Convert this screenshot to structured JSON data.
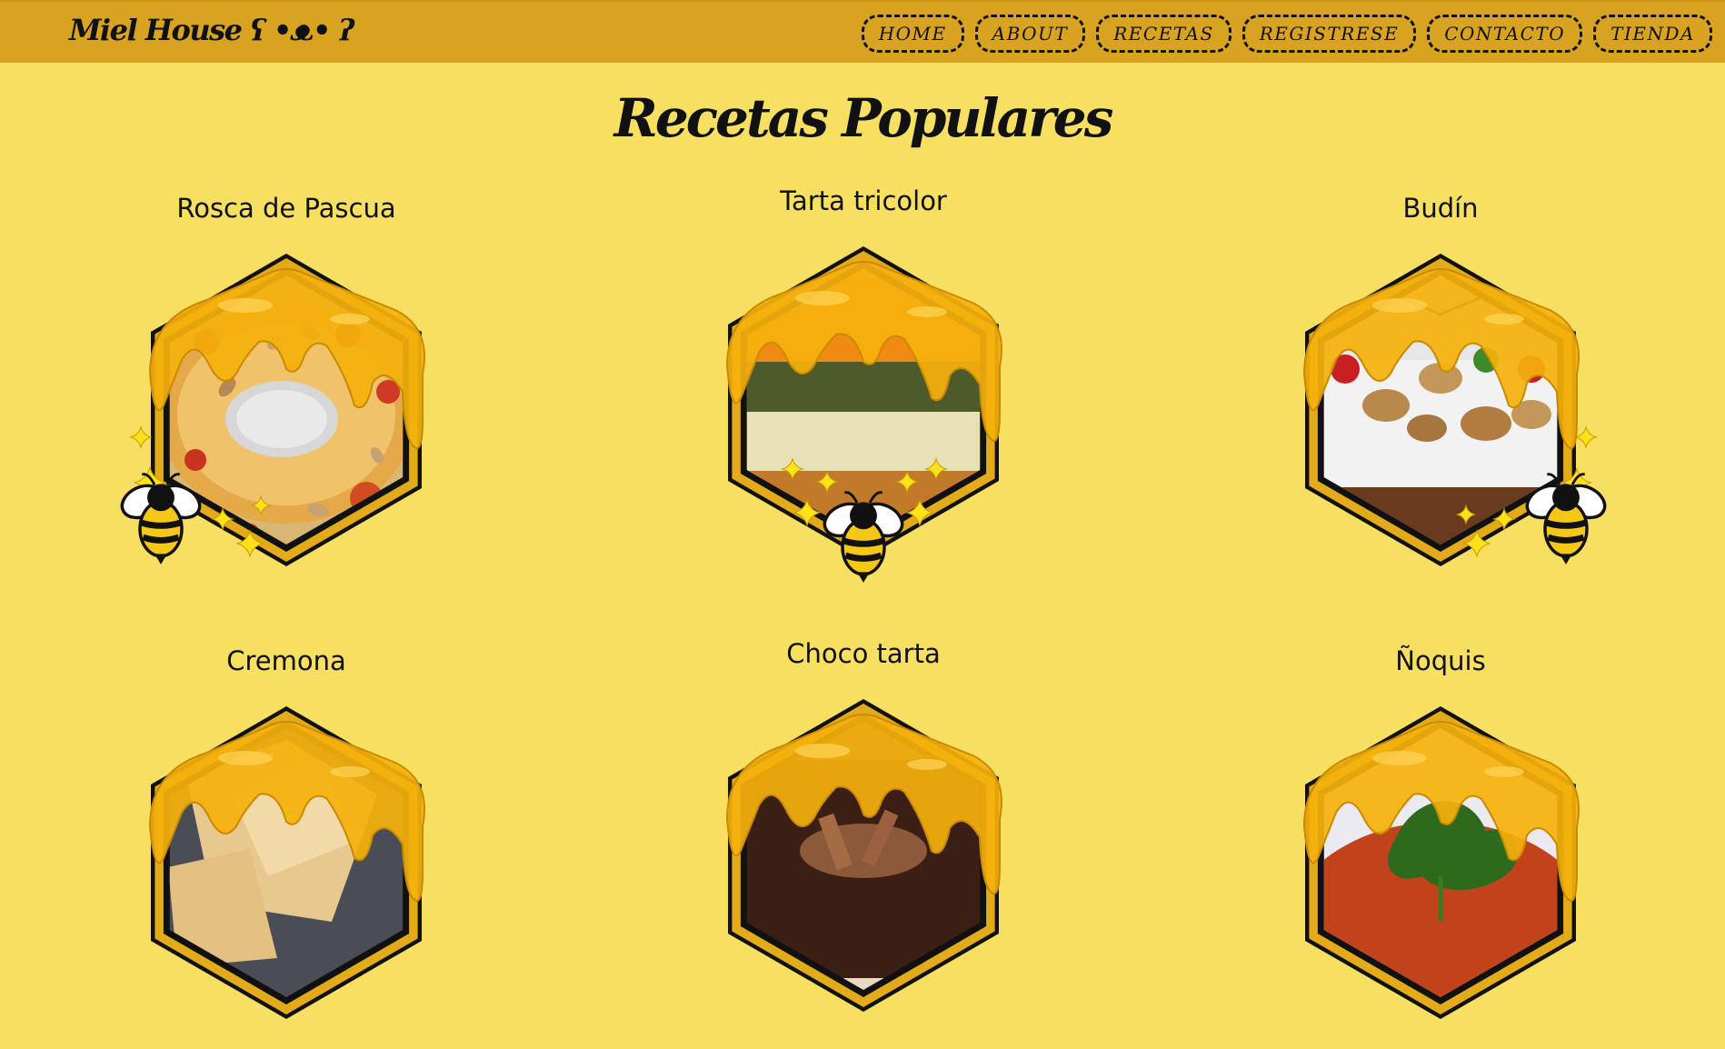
{
  "header": {
    "brand": "Miel House ʕ •ᴥ• ʔ",
    "nav": [
      "HOME",
      "ABOUT",
      "RECETAS",
      "REGISTRESE",
      "CONTACTO",
      "TIENDA"
    ]
  },
  "main": {
    "title": "Recetas Populares",
    "recipes": [
      {
        "name": "Rosca de Pascua"
      },
      {
        "name": "Tarta tricolor"
      },
      {
        "name": "Budín"
      },
      {
        "name": "Cremona"
      },
      {
        "name": "Choco tarta"
      },
      {
        "name": "Ñoquis"
      }
    ]
  },
  "colors": {
    "background": "#f7df62",
    "header": "#d8a320",
    "honey": "#f5b10c",
    "honey_dark": "#c98a00",
    "frame": "#e3aa1a",
    "outline": "#111111"
  },
  "icons": [
    "bee-icon",
    "sparkle-icon",
    "honey-drip-icon"
  ]
}
